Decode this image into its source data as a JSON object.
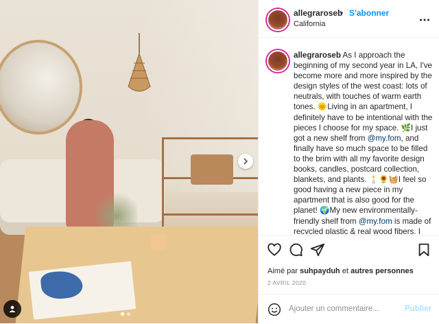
{
  "post": {
    "username": "allegraroseb",
    "separator": "•",
    "follow_label": "S'abonner",
    "location": "California",
    "caption_segments": [
      {
        "text": "As I approach the beginning of my second year in LA, I've become more and more inspired by the design styles of the west coast: lots of neutrals, with touches of warm earth tones. 🌞Living in an apartment, I definitely have to be intentional with the pieces I choose for my space. 🌿I just got a new shelf from "
      },
      {
        "text": "@my.fom",
        "mention": true
      },
      {
        "text": ", and finally have so much space to be filled to the brim with all my favorite design books, candles, postcard collection, blankets, and plants. 🕯️🌻🧺I feel so good having a new piece in my apartment that is also good for the planet! 🌍My new environmentally-friendly shelf from "
      },
      {
        "text": "@my.fom",
        "mention": true
      },
      {
        "text": " is made of recycled plastic & real wood fibers. I always love being inspired by other"
      }
    ],
    "likes_prefix": "Aimé par",
    "liked_by_user": "suhpayduh",
    "likes_conjunction": "et",
    "likes_others": "autres personnes",
    "date": "2 AVRIL 2020",
    "comment_placeholder": "Ajouter un commentaire...",
    "publish_label": "Publier"
  },
  "carousel": {
    "current": 1,
    "total": 2,
    "next_icon": "chevron-right-icon",
    "tag_icon": "user-tag-icon"
  },
  "icons": {
    "header_more": "more-options-icon",
    "like": "heart-icon",
    "comment": "comment-icon",
    "share": "share-icon",
    "save": "bookmark-icon",
    "emoji": "emoji-icon"
  },
  "colors": {
    "link_blue": "#0095f6",
    "mention_blue": "#00376b",
    "muted": "#8e8e8e",
    "publish_disabled": "#b2dffc"
  }
}
